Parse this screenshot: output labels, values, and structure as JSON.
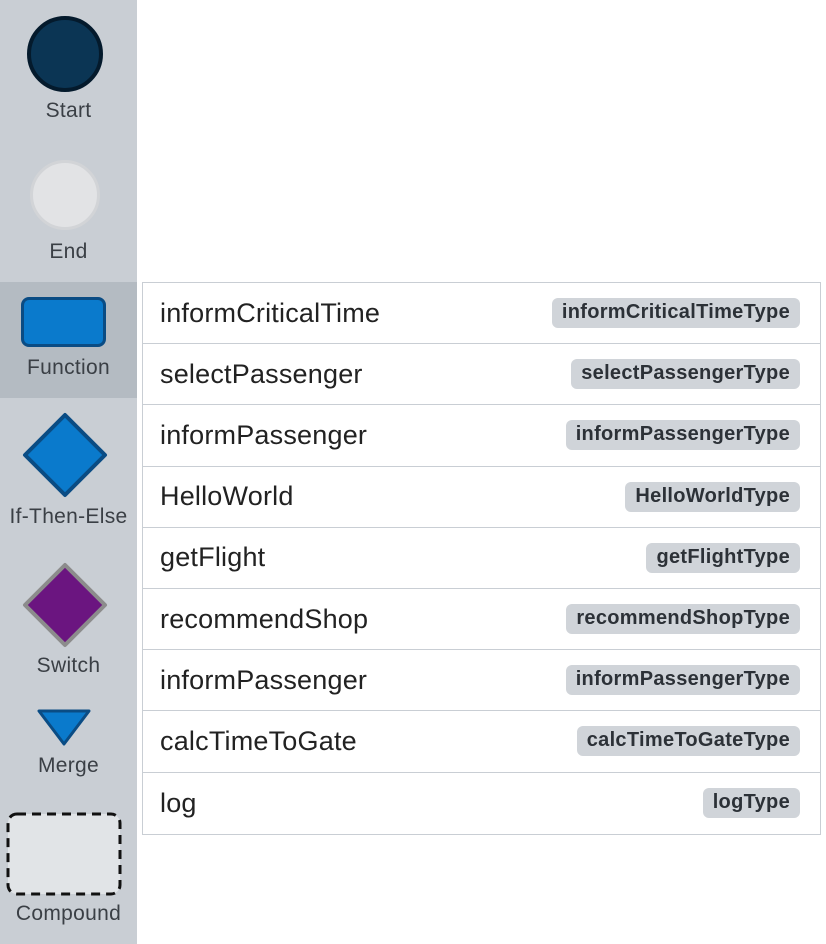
{
  "palette": {
    "items": [
      {
        "label": "Start",
        "icon": "start-circle-icon",
        "color": "#0b3554"
      },
      {
        "label": "End",
        "icon": "end-circle-icon",
        "color": "#e2e3e5"
      },
      {
        "label": "Function",
        "icon": "function-rect-icon",
        "color": "#0a7acc",
        "selected": true
      },
      {
        "label": "If-Then-Else",
        "icon": "diamond-icon",
        "color": "#0a7acc"
      },
      {
        "label": "Switch",
        "icon": "diamond-icon",
        "color": "#6b1580"
      },
      {
        "label": "Merge",
        "icon": "triangle-down-icon",
        "color": "#0a7acc"
      },
      {
        "label": "Compound",
        "icon": "dashed-rect-icon",
        "color": "#e1e4e7"
      }
    ]
  },
  "functions": [
    {
      "name": "informCriticalTime",
      "type": "informCriticalTimeType"
    },
    {
      "name": "selectPassenger",
      "type": "selectPassengerType"
    },
    {
      "name": "informPassenger",
      "type": "informPassengerType"
    },
    {
      "name": "HelloWorld",
      "type": "HelloWorldType"
    },
    {
      "name": "getFlight",
      "type": "getFlightType"
    },
    {
      "name": "recommendShop",
      "type": "recommendShopType"
    },
    {
      "name": "informPassenger",
      "type": "informPassengerType"
    },
    {
      "name": "calcTimeToGate",
      "type": "calcTimeToGateType"
    },
    {
      "name": "log",
      "type": "logType"
    }
  ]
}
